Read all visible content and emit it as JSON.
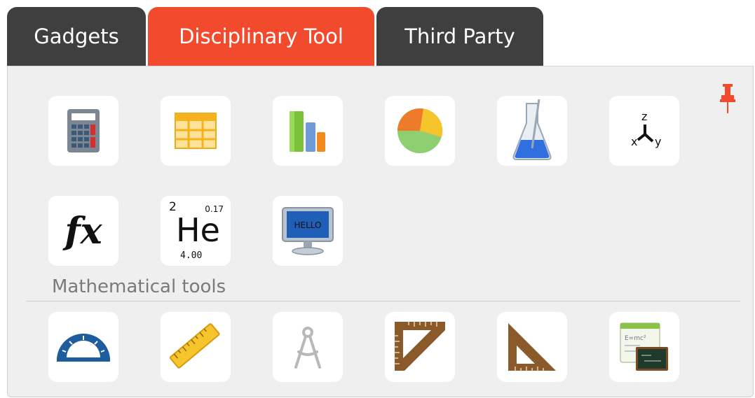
{
  "tabs": [
    {
      "label": "Gadgets",
      "active": false
    },
    {
      "label": "Disciplinary Tool",
      "active": true
    },
    {
      "label": "Third Party",
      "active": false
    }
  ],
  "colors": {
    "tab_active": "#f24a2d",
    "tab_inactive": "#3f3f3f",
    "panel_bg": "#efefef",
    "pin": "#f24a2d"
  },
  "pin": {
    "icon": "pin-icon"
  },
  "tools_row1": [
    {
      "icon": "calculator-icon"
    },
    {
      "icon": "table-icon"
    },
    {
      "icon": "bar-chart-icon"
    },
    {
      "icon": "pie-chart-icon"
    },
    {
      "icon": "flask-icon"
    },
    {
      "icon": "xyz-axes-icon",
      "labels": [
        "z",
        "x",
        "y"
      ]
    }
  ],
  "tools_row2": [
    {
      "icon": "function-icon",
      "text": "fx"
    },
    {
      "icon": "periodic-element-icon",
      "number": "2",
      "mass_top": "0.17",
      "symbol": "He",
      "mass": "4.00"
    },
    {
      "icon": "monitor-icon",
      "screen_text": "HELLO"
    }
  ],
  "section": {
    "label": "Mathematical tools"
  },
  "math_tools": [
    {
      "icon": "protractor-icon"
    },
    {
      "icon": "ruler-icon"
    },
    {
      "icon": "compass-icon"
    },
    {
      "icon": "carpenter-square-icon"
    },
    {
      "icon": "set-square-icon"
    },
    {
      "icon": "equation-board-icon",
      "text": "E=mc²"
    }
  ]
}
